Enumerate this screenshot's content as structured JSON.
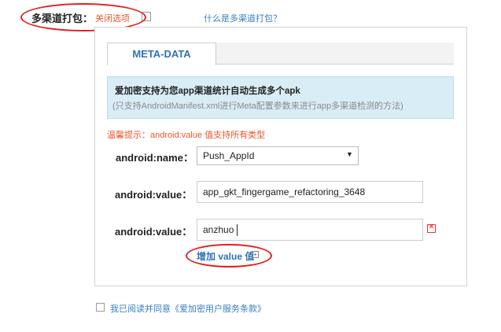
{
  "header": {
    "channel_label": "多渠道打包：",
    "close_option": "关闭选项",
    "help_link": "什么是多渠道打包？"
  },
  "tab": {
    "label": "META-DATA"
  },
  "info": {
    "title": "爱加密支持为您app渠道统计自动生成多个apk",
    "subtitle": "(只支持AndroidManifest.xml进行Meta配置参数来进行app多渠道检测的方法)"
  },
  "tip": "温馨提示：android:value 值支持所有类型",
  "form": {
    "name_label": "android:name：",
    "name_selected": "Push_AppId",
    "value_label_1": "android:value：",
    "value_1": "app_gkt_fingergame_refactoring_3648",
    "value_label_2": "android:value：",
    "value_2": "anzhuo",
    "add_value": "增加 value 值",
    "add_value_icon": "plus-box-icon",
    "delete_icon": "delete-box-icon"
  },
  "agreement": "我已阅读并同意《爱加密用户服务条款》",
  "colors": {
    "accent_blue": "#2f74b5",
    "warning_orange": "#e8572a",
    "highlight_red": "#e02020",
    "info_bg": "#d9edf7"
  }
}
